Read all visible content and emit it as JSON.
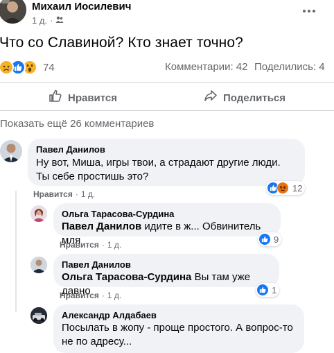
{
  "post": {
    "author": "Михаил Иосилевич",
    "time": "1 д.",
    "privacy_icon": "friends-icon",
    "menu_icon": "more-dots-icon",
    "text": "Что со Славиной? Кто знает точно?",
    "reaction_icons": [
      "sad",
      "like",
      "wow"
    ],
    "reaction_count": "74",
    "comments_label": "Комментарии: 42",
    "shares_label": "Поделились: 4",
    "actions": {
      "like": "Нравится",
      "share": "Поделиться"
    }
  },
  "comments_section": {
    "more_label": "Показать ещё 26 комментариев",
    "comments": [
      {
        "name": "Павел Данилов",
        "text": "Ну вот, Миша, игры твои, а страдают другие люди. Ты себе простишь это?",
        "like_label": "Нравится",
        "time": "1 д.",
        "reaction_count": "12",
        "reactions": [
          "like",
          "angry"
        ]
      },
      {
        "name": "Ольга Тарасова-Сурдина",
        "tag": "Павел Данилов",
        "text": "идите в ж... Обвинитель мля",
        "like_label": "Нравится",
        "time": "1 д.",
        "reaction_count": "9",
        "reactions": [
          "like"
        ]
      },
      {
        "name": "Павел Данилов",
        "tag": "Ольга Тарасова-Сурдина",
        "text": "Вы там уже давно",
        "like_label": "Нравится",
        "time": "1 д.",
        "reaction_count": "1",
        "reactions": [
          "like"
        ]
      },
      {
        "name": "Александр Алдабаев",
        "text_line1": "Посылать в жопу - проще простого. А вопрос-то",
        "text_line2": "не по адресу..."
      }
    ]
  },
  "colors": {
    "like_blue": "#1877f2",
    "angry_orange": "#e9710f",
    "sad_yellow": "#f7b125",
    "bubble_bg": "#f0f2f5",
    "secondary_text": "#65676b"
  }
}
